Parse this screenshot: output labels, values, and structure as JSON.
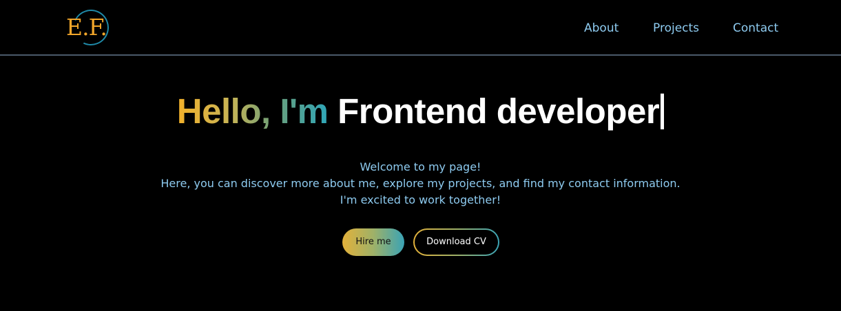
{
  "header": {
    "logo_text": "E.F.",
    "nav": {
      "about": "About",
      "projects": "Projects",
      "contact": "Contact"
    }
  },
  "hero": {
    "greeting": "Hello, I'm",
    "role": "Frontend developer",
    "intro_line1": "Welcome to my page!",
    "intro_line2": "Here, you can discover more about me, explore my projects, and find my contact information.",
    "intro_line3": "I'm excited to work together!",
    "hire_label": "Hire me",
    "cv_label": "Download CV"
  },
  "colors": {
    "background": "#000000",
    "accent_gold": "#f2b12a",
    "accent_teal": "#2fa6b8",
    "link_blue": "#8ecbf0",
    "divider": "#4a5a6a"
  },
  "icons": {
    "logo": "ef-monogram-logo",
    "cursor": "typing-cursor"
  }
}
